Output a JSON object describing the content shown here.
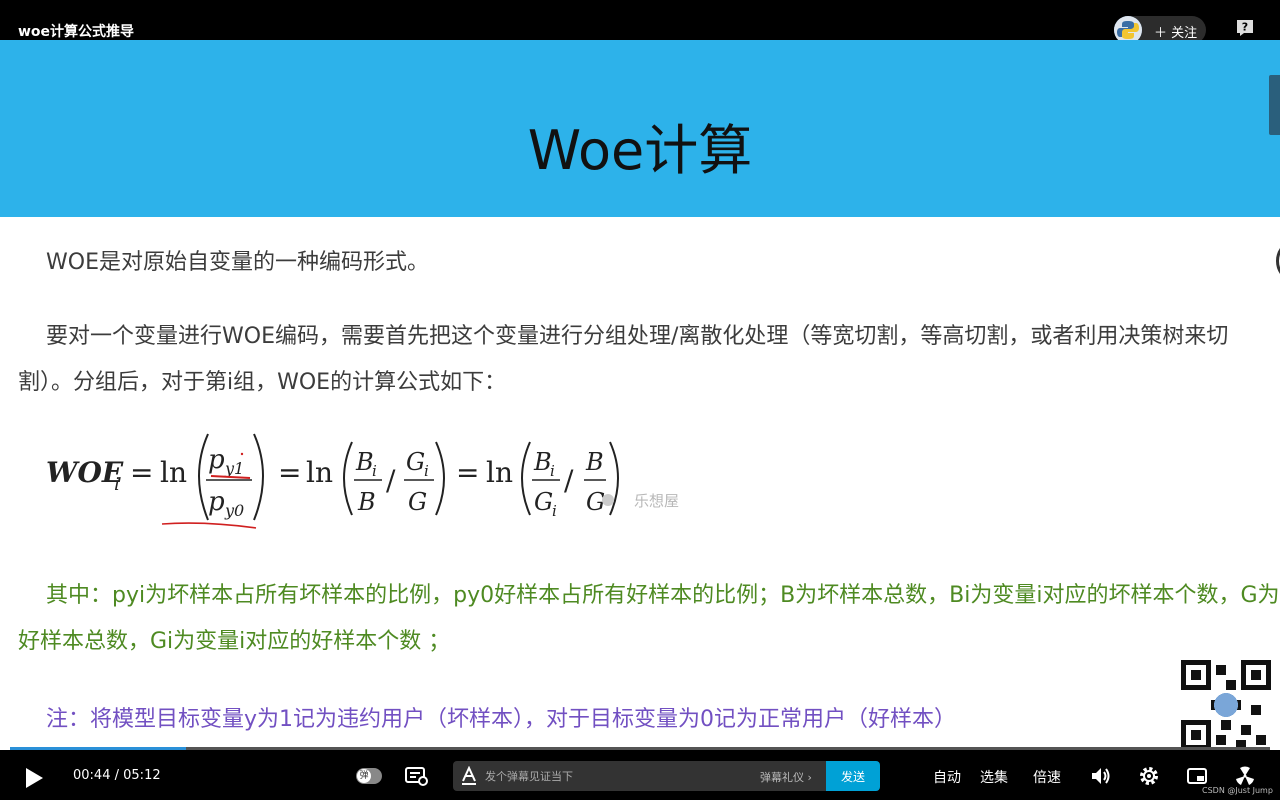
{
  "player": {
    "title": "woe计算公式推导",
    "follow_label": "关注",
    "help_icon": "help-icon"
  },
  "slide": {
    "title": "Woe计算",
    "paragraph1": "WOE是对原始自变量的一种编码形式。",
    "paragraph2": "要对一个变量进行WOE编码，需要首先把这个变量进行分组处理/离散化处理（等宽切割，等高切割，或者利用决策树来切割）。分组后，对于第i组，WOE的计算公式如下：",
    "formula": {
      "lhs": "WOE",
      "lhs_sub": "i",
      "ln1": "ln",
      "ln2": "ln",
      "ln3": "ln",
      "eq": "=",
      "slash": "/",
      "frac1_num": "p",
      "frac1_num_sub": "y1",
      "frac1_den": "p",
      "frac1_den_sub": "y0",
      "f2a_num": "B",
      "f2a_num_sub": "i",
      "f2a_den": "B",
      "f2b_num": "G",
      "f2b_num_sub": "i",
      "f2b_den": "G",
      "f3a_num": "B",
      "f3a_num_sub": "i",
      "f3a_den": "G",
      "f3a_den_sub": "i",
      "f3b_num": "B",
      "f3b_den": "G",
      "watermark": "乐想屋"
    },
    "paragraph3": "其中：pyi为坏样本占所有坏样本的比例，py0好样本占所有好样本的比例；B为坏样本总数，Bi为变量i对应的坏样本个数，G为好样本总数，Gi为变量i对应的好样本个数 ；",
    "paragraph4": "注：将模型目标变量y为1记为违约用户（坏样本），对于目标变量为0记为正常用户（好样本）",
    "colors": {
      "header_bg": "#2db2ea",
      "green_text": "#4e8a22",
      "purple_text": "#7250c2"
    }
  },
  "progress": {
    "played_fraction": 0.14
  },
  "controls": {
    "current_time": "00:44",
    "separator": "/",
    "duration": "05:12",
    "danmaku_toggle_label": "弹",
    "danmaku_placeholder": "发个弹幕见证当下",
    "danmaku_etiquette": "弹幕礼仪",
    "send_label": "发送",
    "autoplay_label": "自动",
    "episodes_label": "选集",
    "speed_label": "倍速"
  },
  "watermark": "CSDN @Just Jump"
}
